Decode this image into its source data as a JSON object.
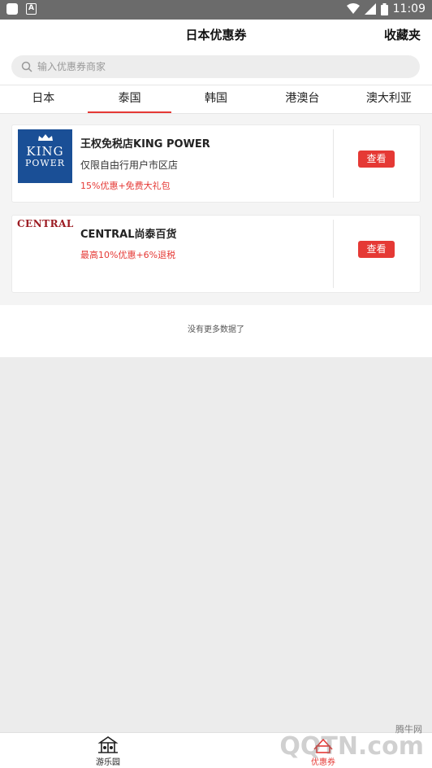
{
  "status_bar": {
    "time": "11:09"
  },
  "header": {
    "title": "日本优惠券",
    "favorites": "收藏夹"
  },
  "search": {
    "placeholder": "输入优惠券商家"
  },
  "tabs": [
    {
      "label": "日本"
    },
    {
      "label": "泰国"
    },
    {
      "label": "韩国"
    },
    {
      "label": "港澳台"
    },
    {
      "label": "澳大利亚"
    }
  ],
  "active_tab": "泰国",
  "coupons": [
    {
      "logo_lines": [
        "KING",
        "POWER"
      ],
      "name": "王权免税店KING POWER",
      "desc": "仅限自由行用户市区店",
      "promo": "15%优惠+免费大礼包",
      "button": "查看"
    },
    {
      "logo_text": "CENTRAL",
      "name": "CENTRAL尚泰百货",
      "promo": "最高10%优惠+6%退税",
      "button": "查看"
    }
  ],
  "no_more": "没有更多数据了",
  "tabbar": [
    {
      "label": "游乐园",
      "icon": "park-icon"
    },
    {
      "label": "优惠券",
      "icon": "coupon-icon"
    }
  ],
  "watermark": {
    "text": "QQTN.com",
    "small": "腾牛网"
  },
  "colors": {
    "accent": "#e53935",
    "kingpower_blue": "#1a4f96",
    "central_red": "#9c1b22"
  }
}
